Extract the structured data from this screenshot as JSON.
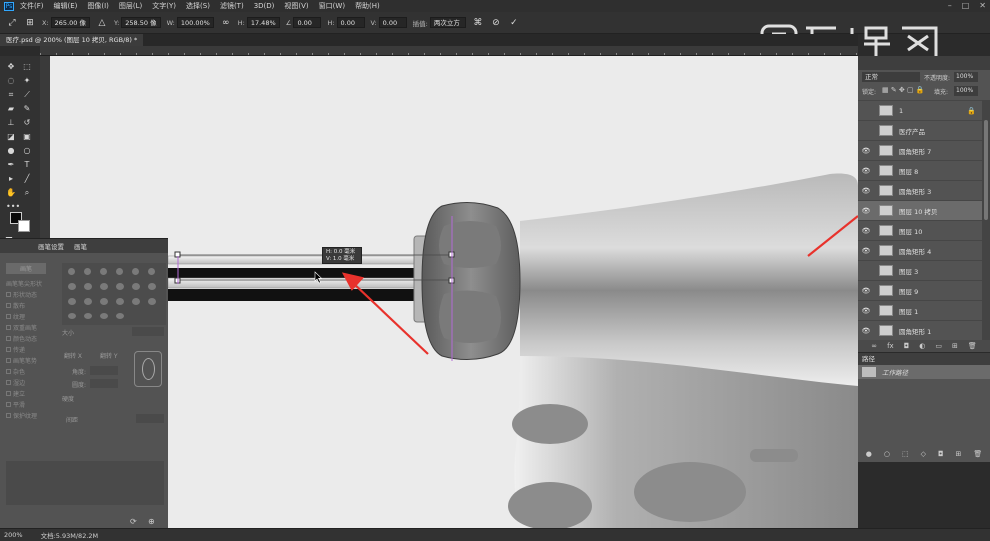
{
  "menu": {
    "items": [
      "文件(F)",
      "编辑(E)",
      "图像(I)",
      "图层(L)",
      "文字(Y)",
      "选择(S)",
      "滤镜(T)",
      "3D(D)",
      "视图(V)",
      "窗口(W)",
      "帮助(H)"
    ]
  },
  "options": {
    "x_label": "X:",
    "x_value": "265.00 像",
    "y_label": "Y:",
    "y_value": "258.50 像",
    "w_label": "W:",
    "w_value": "100.00%",
    "h_label": "H:",
    "h_value": "17.48%",
    "angle_value": "0.00",
    "hskew_label": "H:",
    "hskew_value": "0.00",
    "vskew_label": "V:",
    "vskew_value": "0.00",
    "interp_label": "插值:",
    "interp_value": "两次立方"
  },
  "document": {
    "tab_title": "医疗.psd @ 200% (图层 10 拷贝, RGB/8) *"
  },
  "transform_tooltip": {
    "line1": "0.0 毫米",
    "line2": "1.0 毫米"
  },
  "brush_panel": {
    "tab1": "画笔设置",
    "tab2": "画笔",
    "preset_button": "画笔",
    "tip_shape": "画笔笔尖形状",
    "options": [
      "形状动态",
      "散布",
      "纹理",
      "双重画笔",
      "颜色动态",
      "传递",
      "画笔笔势",
      "杂色",
      "湿边",
      "建立",
      "平滑",
      "保护纹理"
    ],
    "size_label": "大小",
    "flip_x": "翻转 X",
    "flip_y": "翻转 Y",
    "angle_label": "角度:",
    "roundness_label": "圆度:",
    "hardness_label": "硬度",
    "spacing_label": "间距"
  },
  "layers_panel": {
    "blend_mode": "正常",
    "opacity_label": "不透明度:",
    "opacity_value": "100%",
    "lock_label": "锁定:",
    "fill_label": "填充:",
    "fill_value": "100%",
    "layers": [
      {
        "name": "1",
        "visible": false,
        "selected": false
      },
      {
        "name": "医疗产品",
        "visible": false,
        "selected": false
      },
      {
        "name": "圆角矩形 7",
        "visible": true,
        "selected": false
      },
      {
        "name": "图层 8",
        "visible": true,
        "selected": false
      },
      {
        "name": "圆角矩形 3",
        "visible": true,
        "selected": false
      },
      {
        "name": "图层 10 拷贝",
        "visible": true,
        "selected": true
      },
      {
        "name": "图层 10",
        "visible": true,
        "selected": false
      },
      {
        "name": "圆角矩形 4",
        "visible": true,
        "selected": false
      },
      {
        "name": "图层 3",
        "visible": false,
        "selected": false
      },
      {
        "name": "图层 9",
        "visible": true,
        "selected": false
      },
      {
        "name": "图层 1",
        "visible": true,
        "selected": false
      },
      {
        "name": "圆角矩形 1",
        "visible": true,
        "selected": false
      }
    ]
  },
  "paths_panel": {
    "title": "路径",
    "item": "工作路径"
  },
  "status": {
    "zoom": "200%",
    "doc_size": "文档:5.93M/82.2M"
  },
  "watermark": {
    "text": "虎课网"
  },
  "colors": {
    "canvas": "#ebebeb",
    "arrow": "#e8322c",
    "selection": "#b36bd6"
  }
}
